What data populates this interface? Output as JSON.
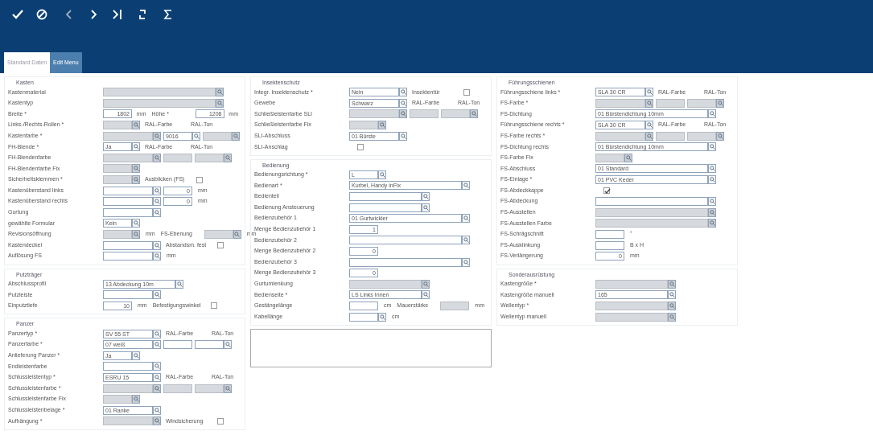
{
  "tabs": [
    {
      "label": "Standard Daten",
      "selected": true
    },
    {
      "label": "Edit Menu",
      "selected": false
    }
  ],
  "columns": [
    [
      {
        "title": "Kasten",
        "rows": [
          {
            "label": "Kastenmaterial",
            "controls": [
              {
                "kind": "long-field",
                "disabled": true,
                "lookup": true
              }
            ]
          },
          {
            "label": "Kastentyp",
            "controls": [
              {
                "kind": "long-field",
                "disabled": true,
                "lookup": true
              }
            ]
          },
          {
            "label": "Breite *",
            "controls": [
              {
                "kind": "number-field",
                "value": "1802",
                "disabled": false,
                "lookup": false
              },
              {
                "kind": "unit",
                "text": "mm"
              },
              {
                "kind": "label",
                "text": "Höhe *"
              },
              {
                "kind": "number-field",
                "value": "1208",
                "disabled": false,
                "lookup": false
              },
              {
                "kind": "unit",
                "text": "mm"
              }
            ]
          },
          {
            "label": "Links-/Rechts-Rollen *",
            "controls": [
              {
                "kind": "short-field",
                "disabled": true,
                "lookup": true
              },
              {
                "kind": "label",
                "text": "RAL-Farbe"
              },
              {
                "kind": "label",
                "text": "RAL-Ton"
              }
            ]
          },
          {
            "label": "Kastenfarbe *",
            "controls": [
              {
                "kind": "field",
                "disabled": true,
                "lookup": true
              },
              {
                "kind": "short-field",
                "value": "9016",
                "disabled": false,
                "lookup": true
              },
              {
                "kind": "short-field",
                "disabled": true,
                "lookup": true
              }
            ]
          },
          {
            "label": "FH-Blende *",
            "controls": [
              {
                "kind": "short-field",
                "value": "Ja",
                "disabled": false,
                "lookup": true
              },
              {
                "kind": "label",
                "text": "RAL-Farbe"
              },
              {
                "kind": "label",
                "text": "RAL-Ton"
              }
            ]
          },
          {
            "label": "FH-Blendenfarbe",
            "controls": [
              {
                "kind": "field",
                "disabled": true,
                "lookup": true
              },
              {
                "kind": "short-field",
                "disabled": true,
                "lookup": false
              },
              {
                "kind": "short-field",
                "disabled": true,
                "lookup": true
              }
            ]
          },
          {
            "label": "FH-Blendenfarbe Fix",
            "controls": [
              {
                "kind": "short-field",
                "disabled": true,
                "lookup": true
              }
            ]
          },
          {
            "label": "Sicherheitsklemmen *",
            "controls": [
              {
                "kind": "short-field",
                "disabled": true,
                "lookup": true
              },
              {
                "kind": "label",
                "text": "Ausblicken (FS)"
              },
              {
                "kind": "checkbox",
                "checked": false
              }
            ]
          },
          {
            "label": "Kastenüberstand links",
            "controls": [
              {
                "kind": "field",
                "disabled": false,
                "lookup": true
              },
              {
                "kind": "number-field",
                "value": "0",
                "disabled": false,
                "lookup": false
              },
              {
                "kind": "unit",
                "text": "mm"
              }
            ]
          },
          {
            "label": "Kastenüberstand rechts",
            "controls": [
              {
                "kind": "field",
                "disabled": false,
                "lookup": true
              },
              {
                "kind": "number-field",
                "value": "0",
                "disabled": false,
                "lookup": false
              },
              {
                "kind": "unit",
                "text": "mm"
              }
            ]
          },
          {
            "label": "Gurtung",
            "controls": [
              {
                "kind": "field",
                "disabled": false,
                "lookup": true
              }
            ]
          },
          {
            "label": "gewählte Formular",
            "controls": [
              {
                "kind": "short-field",
                "value": "Kein",
                "disabled": false,
                "lookup": true
              }
            ]
          },
          {
            "label": "Revisionsöffnung",
            "controls": [
              {
                "kind": "short-field",
                "disabled": true,
                "lookup": true
              },
              {
                "kind": "unit",
                "text": "mm"
              },
              {
                "kind": "label",
                "text": "FS-Ebenung"
              },
              {
                "kind": "short-field",
                "disabled": true,
                "lookup": true
              },
              {
                "kind": "unit",
                "text": "mm"
              }
            ]
          },
          {
            "label": "Kastendeckel",
            "controls": [
              {
                "kind": "field",
                "disabled": false,
                "lookup": true
              },
              {
                "kind": "label",
                "text": "Abstandsm. fest"
              },
              {
                "kind": "checkbox",
                "checked": false
              }
            ]
          },
          {
            "label": "Auflösung FS",
            "controls": [
              {
                "kind": "field",
                "disabled": false,
                "lookup": true
              },
              {
                "kind": "unit",
                "text": "mm"
              }
            ]
          }
        ]
      },
      {
        "title": "Putzträger",
        "rows": [
          {
            "label": "Abschlussprofil",
            "controls": [
              {
                "kind": "wide-field",
                "value": "13 Abdeckung 10m",
                "disabled": false,
                "lookup": true
              }
            ]
          },
          {
            "label": "Putzleiste",
            "controls": [
              {
                "kind": "field",
                "disabled": false,
                "lookup": true
              }
            ]
          },
          {
            "label": "Einputztiefe",
            "controls": [
              {
                "kind": "number-field",
                "value": "10",
                "disabled": false,
                "lookup": false
              },
              {
                "kind": "unit",
                "text": "mm"
              },
              {
                "kind": "label",
                "text": "Befestigungswinkel"
              },
              {
                "kind": "checkbox",
                "checked": false
              }
            ]
          }
        ]
      },
      {
        "title": "Panzer",
        "rows": [
          {
            "label": "Panzertyp *",
            "controls": [
              {
                "kind": "field",
                "value": "SV 55 ST",
                "disabled": false,
                "lookup": true
              },
              {
                "kind": "label",
                "text": "RAL-Farbe"
              },
              {
                "kind": "label",
                "text": "RAL-Ton"
              }
            ]
          },
          {
            "label": "Panzerfarbe *",
            "controls": [
              {
                "kind": "field",
                "value": "07 weiß",
                "disabled": false,
                "lookup": true
              },
              {
                "kind": "short-field",
                "disabled": false,
                "lookup": false
              },
              {
                "kind": "short-field",
                "disabled": false,
                "lookup": true
              }
            ]
          },
          {
            "label": "Anlieferung Panzer *",
            "controls": [
              {
                "kind": "short-field",
                "value": "Ja",
                "disabled": false,
                "lookup": true
              }
            ]
          },
          {
            "label": "Endleistenfarbe",
            "controls": [
              {
                "kind": "field",
                "disabled": false,
                "lookup": true
              }
            ]
          },
          {
            "label": "Schlussleistentyp *",
            "controls": [
              {
                "kind": "field",
                "value": "ESRU 15",
                "disabled": false,
                "lookup": true
              },
              {
                "kind": "label",
                "text": "RAL-Farbe"
              },
              {
                "kind": "label",
                "text": "RAL-Ton"
              }
            ]
          },
          {
            "label": "Schlussleistenfarbe *",
            "controls": [
              {
                "kind": "field",
                "disabled": true,
                "lookup": true
              },
              {
                "kind": "short-field",
                "disabled": true,
                "lookup": false
              },
              {
                "kind": "short-field",
                "disabled": true,
                "lookup": true
              }
            ]
          },
          {
            "label": "Schlussleistenfarbe Fix",
            "controls": [
              {
                "kind": "short-field",
                "disabled": true,
                "lookup": true
              }
            ]
          },
          {
            "label": "Schlussleistenbelage *",
            "controls": [
              {
                "kind": "field",
                "value": "01 Ranke",
                "disabled": false,
                "lookup": true
              }
            ]
          },
          {
            "label": "Aufhängung *",
            "controls": [
              {
                "kind": "field",
                "disabled": true,
                "lookup": true
              },
              {
                "kind": "label",
                "text": "Windsicherung"
              },
              {
                "kind": "checkbox",
                "checked": false
              }
            ]
          }
        ]
      }
    ],
    [
      {
        "title": "Insektenschutz",
        "rows": [
          {
            "label": "Integr. Insektenschutz *",
            "controls": [
              {
                "kind": "field",
                "value": "Nein",
                "disabled": false,
                "lookup": true
              },
              {
                "kind": "label",
                "text": "Insektentür"
              },
              {
                "kind": "checkbox",
                "checked": false
              }
            ]
          },
          {
            "label": "Gewebe",
            "controls": [
              {
                "kind": "field",
                "value": "Schwarz",
                "disabled": false,
                "lookup": true
              },
              {
                "kind": "label",
                "text": "RAL-Farbe"
              },
              {
                "kind": "label",
                "text": "RAL-Ton"
              }
            ]
          },
          {
            "label": "Schließleistenfarbe SLI",
            "controls": [
              {
                "kind": "field",
                "disabled": true,
                "lookup": true
              },
              {
                "kind": "short-field",
                "disabled": true,
                "lookup": false
              },
              {
                "kind": "short-field",
                "disabled": true,
                "lookup": true
              }
            ]
          },
          {
            "label": "Schließleistenfarbe Fix",
            "controls": [
              {
                "kind": "short-field",
                "disabled": true,
                "lookup": true
              }
            ]
          },
          {
            "label": "SLI-Abschluss",
            "controls": [
              {
                "kind": "field",
                "value": "01 Bürste",
                "disabled": false,
                "lookup": true
              }
            ]
          },
          {
            "label": "SLI-Anschlag",
            "controls": [
              {
                "kind": "checkbox",
                "checked": false
              }
            ]
          }
        ]
      },
      {
        "title": "Bedienung",
        "rows": [
          {
            "label": "Bedienungsrichtung *",
            "controls": [
              {
                "kind": "short-field",
                "value": "L",
                "disabled": false,
                "lookup": true
              }
            ]
          },
          {
            "label": "Bedienart *",
            "controls": [
              {
                "kind": "long-field",
                "value": "Kurbel, Handy inFix",
                "disabled": false,
                "lookup": true
              }
            ]
          },
          {
            "label": "Bedienteil",
            "controls": [
              {
                "kind": "wide-field",
                "disabled": false,
                "lookup": true
              }
            ]
          },
          {
            "label": "Bedienung Ansteuerung",
            "controls": [
              {
                "kind": "wide-field",
                "disabled": false,
                "lookup": true
              }
            ]
          },
          {
            "label": "Bedienzubehör 1",
            "controls": [
              {
                "kind": "long-field",
                "value": "01 Gurtwickler",
                "disabled": false,
                "lookup": true
              }
            ]
          },
          {
            "label": "Menge Bedienzubehör 1",
            "controls": [
              {
                "kind": "number-field",
                "value": "1",
                "disabled": false,
                "lookup": false
              }
            ]
          },
          {
            "label": "Bedienzubehör 2",
            "controls": [
              {
                "kind": "long-field",
                "disabled": false,
                "lookup": true
              }
            ]
          },
          {
            "label": "Menge Bedienzubehör 2",
            "controls": [
              {
                "kind": "number-field",
                "value": "0",
                "disabled": false,
                "lookup": false
              }
            ]
          },
          {
            "label": "Bedienzubehör 3",
            "controls": [
              {
                "kind": "long-field",
                "disabled": false,
                "lookup": true
              }
            ]
          },
          {
            "label": "Menge Bedienzubehör 3",
            "controls": [
              {
                "kind": "number-field",
                "value": "0",
                "disabled": false,
                "lookup": false
              }
            ]
          },
          {
            "label": "Gurtumlenkung",
            "controls": [
              {
                "kind": "wide-field",
                "disabled": true,
                "lookup": true
              }
            ]
          },
          {
            "label": "Bedienseite *",
            "controls": [
              {
                "kind": "wide-field",
                "value": "LS Links Innen",
                "disabled": false,
                "lookup": true
              }
            ]
          },
          {
            "label": "Gestängelänge",
            "controls": [
              {
                "kind": "number-field",
                "disabled": false,
                "lookup": false
              },
              {
                "kind": "unit",
                "text": "cm"
              },
              {
                "kind": "label",
                "text": "Mauerstärke"
              },
              {
                "kind": "number-field",
                "disabled": true,
                "lookup": false
              },
              {
                "kind": "unit",
                "text": "mm"
              }
            ]
          },
          {
            "label": "Kabellänge",
            "controls": [
              {
                "kind": "short-field",
                "disabled": false,
                "lookup": true
              },
              {
                "kind": "unit",
                "text": "cm"
              }
            ]
          }
        ]
      }
    ],
    [
      {
        "title": "Führungsschienen",
        "rows": [
          {
            "label": "Führungsschiene links *",
            "controls": [
              {
                "kind": "field",
                "value": "SLA 30 CR",
                "disabled": false,
                "lookup": true
              },
              {
                "kind": "label",
                "text": "RAL-Farbe"
              },
              {
                "kind": "label",
                "text": "RAL-Ton"
              }
            ]
          },
          {
            "label": "FS-Farbe *",
            "controls": [
              {
                "kind": "field",
                "disabled": true,
                "lookup": true
              },
              {
                "kind": "short-field",
                "disabled": true,
                "lookup": false
              },
              {
                "kind": "short-field",
                "disabled": true,
                "lookup": true
              }
            ]
          },
          {
            "label": "FS-Dichtung",
            "controls": [
              {
                "kind": "long-field",
                "value": "01 Bürstendichtung 10mm",
                "disabled": false,
                "lookup": true
              }
            ]
          },
          {
            "label": "Führungsschiene rechts *",
            "controls": [
              {
                "kind": "field",
                "value": "SLA 30 CR",
                "disabled": false,
                "lookup": true
              },
              {
                "kind": "label",
                "text": "RAL-Farbe"
              },
              {
                "kind": "label",
                "text": "RAL-Ton"
              }
            ]
          },
          {
            "label": "FS-Farbe rechts *",
            "controls": [
              {
                "kind": "field",
                "disabled": true,
                "lookup": true
              },
              {
                "kind": "short-field",
                "disabled": true,
                "lookup": false
              },
              {
                "kind": "short-field",
                "disabled": true,
                "lookup": true
              }
            ]
          },
          {
            "label": "FS-Dichtung rechts",
            "controls": [
              {
                "kind": "long-field",
                "value": "01 Bürstendichtung 10mm",
                "disabled": false,
                "lookup": true
              }
            ]
          },
          {
            "label": "FS-Farbe Fix",
            "controls": [
              {
                "kind": "short-field",
                "disabled": true,
                "lookup": true
              }
            ]
          },
          {
            "label": "FS-Abschluss",
            "controls": [
              {
                "kind": "long-field",
                "value": "01 Standard",
                "disabled": false,
                "lookup": true
              }
            ]
          },
          {
            "label": "FS-Einlage *",
            "controls": [
              {
                "kind": "long-field",
                "value": "01 PVC Keder",
                "disabled": false,
                "lookup": true
              }
            ]
          },
          {
            "label": "FS-Abdeckkappe",
            "controls": [
              {
                "kind": "checkbox",
                "checked": true
              }
            ]
          },
          {
            "label": "FS-Abdeckung",
            "controls": [
              {
                "kind": "long-field",
                "disabled": false,
                "lookup": true
              }
            ]
          },
          {
            "label": "FS-Ausstellen",
            "controls": [
              {
                "kind": "long-field",
                "disabled": true,
                "lookup": true
              }
            ]
          },
          {
            "label": "FS-Ausstellen Farbe",
            "controls": [
              {
                "kind": "long-field",
                "disabled": true,
                "lookup": true
              }
            ]
          },
          {
            "label": "FS-Schrägschnitt",
            "controls": [
              {
                "kind": "number-field",
                "disabled": false,
                "lookup": false
              },
              {
                "kind": "unit",
                "text": "°"
              }
            ]
          },
          {
            "label": "FS-Ausklinkung",
            "controls": [
              {
                "kind": "number-field",
                "disabled": false,
                "lookup": false
              },
              {
                "kind": "unit",
                "text": "B x H"
              }
            ]
          },
          {
            "label": "FS-Verlängerung",
            "controls": [
              {
                "kind": "number-field",
                "value": "0",
                "disabled": false,
                "lookup": false
              },
              {
                "kind": "unit",
                "text": "mm"
              }
            ]
          }
        ]
      },
      {
        "title": "Sonderausrüstung",
        "rows": [
          {
            "label": "Kastengröße *",
            "controls": [
              {
                "kind": "wide-field",
                "disabled": true,
                "lookup": true
              }
            ]
          },
          {
            "label": "Kastengröße manuell",
            "controls": [
              {
                "kind": "wide-field",
                "value": "165",
                "disabled": false,
                "lookup": true
              }
            ]
          },
          {
            "label": "Wellentyp *",
            "controls": [
              {
                "kind": "wide-field",
                "disabled": true,
                "lookup": true
              }
            ]
          },
          {
            "label": "Wellentyp manuell",
            "controls": [
              {
                "kind": "wide-field",
                "disabled": true,
                "lookup": true
              }
            ]
          }
        ]
      }
    ]
  ]
}
